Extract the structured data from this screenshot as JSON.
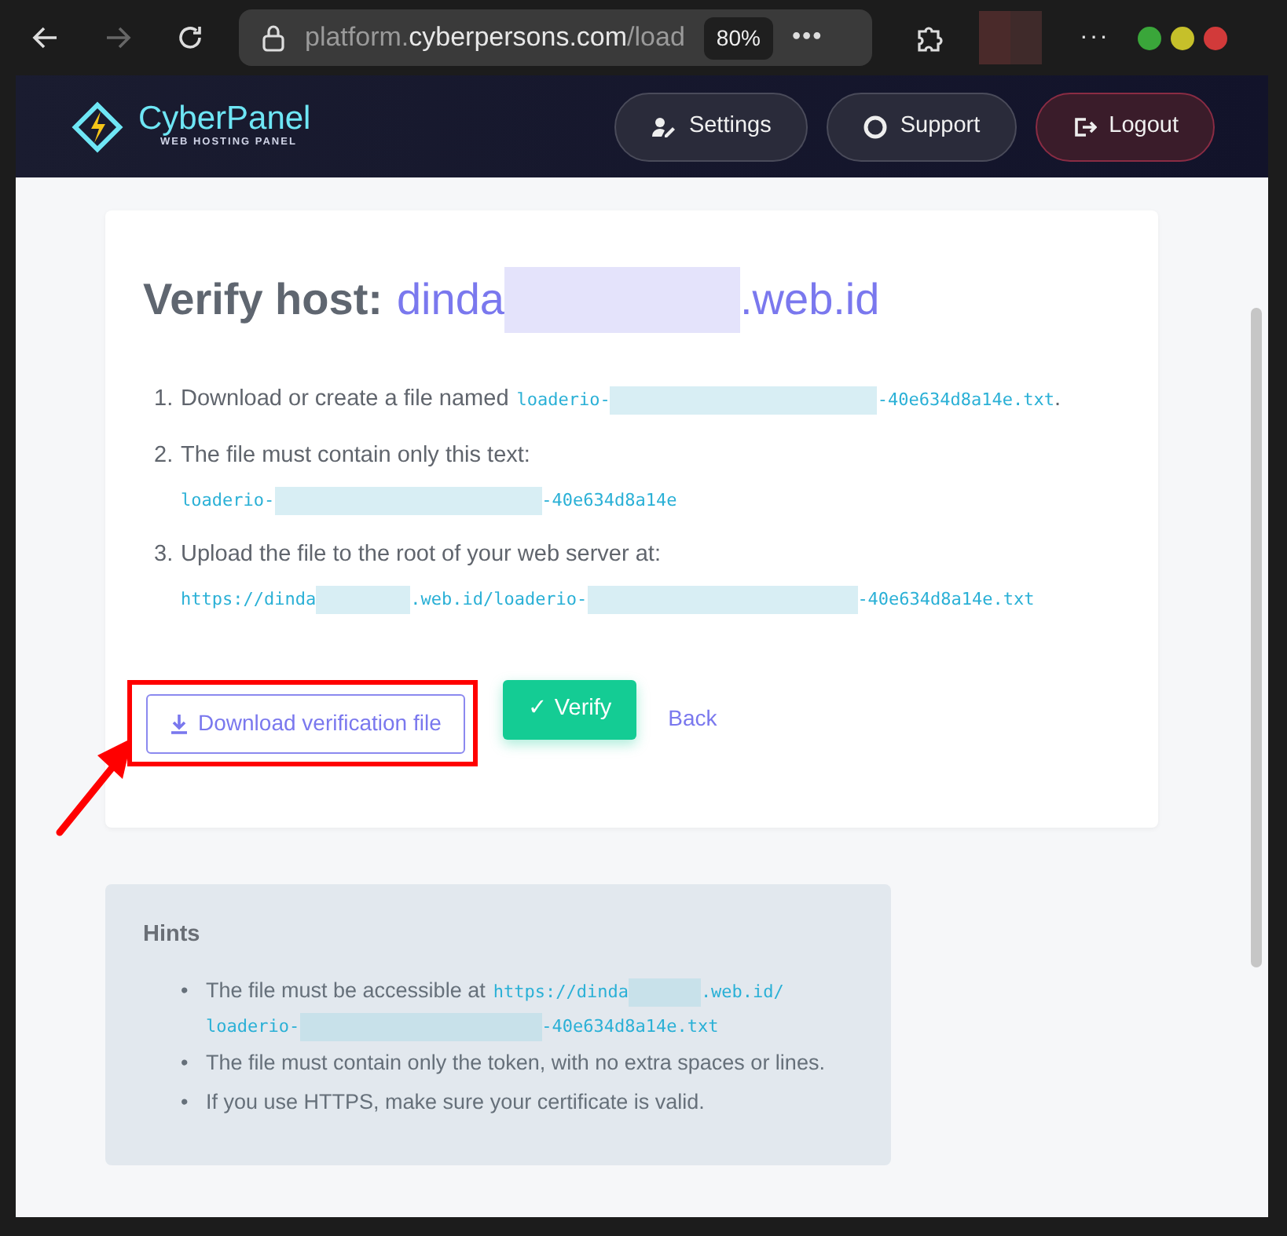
{
  "browser": {
    "url_host": "platform.",
    "url_domain": "cyberpersons.com",
    "url_path": "/load",
    "zoom": "80%",
    "menu": "•••",
    "more": "···",
    "forward_disabled": true
  },
  "navbar": {
    "brand": "CyberPanel",
    "tagline": "WEB HOSTING PANEL",
    "buttons": [
      {
        "label": "Settings",
        "kind": "settings"
      },
      {
        "label": "Support",
        "kind": "support"
      },
      {
        "label": "Logout",
        "kind": "logout"
      }
    ]
  },
  "card": {
    "title": "Verify host:",
    "host": [
      {
        "text": "dinda"
      },
      {
        "kind": "redacted"
      },
      {
        "text": ".web.id"
      }
    ],
    "steps": [
      {
        "number": "1.",
        "text": "Download or create a file named",
        "code": [
          {
            "text": "loaderio-"
          },
          {
            "kind": "redacted"
          },
          {
            "text": "-40e634d8a14e.txt"
          }
        ],
        "after": "."
      },
      {
        "number": "2.",
        "text": "The file must contain only this text:",
        "code_block": [
          {
            "text": "loaderio-"
          },
          {
            "kind": "redacted"
          },
          {
            "text": "-40e634d8a14e"
          }
        ]
      },
      {
        "number": "3.",
        "text": "Upload the file to the root of your web server at:",
        "code_block": [
          {
            "text": "https://dinda"
          },
          {
            "kind": "redacted"
          },
          {
            "text": ".web.id/loaderio-"
          },
          {
            "kind": "redacted"
          },
          {
            "text": "-40e634d8a14e.txt"
          }
        ]
      }
    ],
    "download_button": "Download verification file",
    "verify_button": "Verify",
    "verify_icon": "✓",
    "back_link": "Back"
  },
  "hints": {
    "title": "Hints",
    "items": [
      {
        "marker": "•",
        "text": "The file must be accessible at",
        "code": [
          {
            "text": "https://dinda"
          },
          {
            "kind": "redacted"
          },
          {
            "text": ".web.id/"
          }
        ],
        "code2": [
          {
            "text": "loaderio-"
          },
          {
            "kind": "redacted"
          },
          {
            "text": "-40e634d8a14e.txt"
          }
        ]
      },
      {
        "marker": "•",
        "text": "The file must contain only the token, with no extra spaces or lines."
      },
      {
        "marker": "•",
        "text": "If you use HTTPS, make sure your certificate is valid."
      }
    ]
  },
  "annotations": {
    "highlight_box": {
      "color": "#ff0000"
    },
    "arrow": {
      "color": "#ff0000"
    }
  }
}
